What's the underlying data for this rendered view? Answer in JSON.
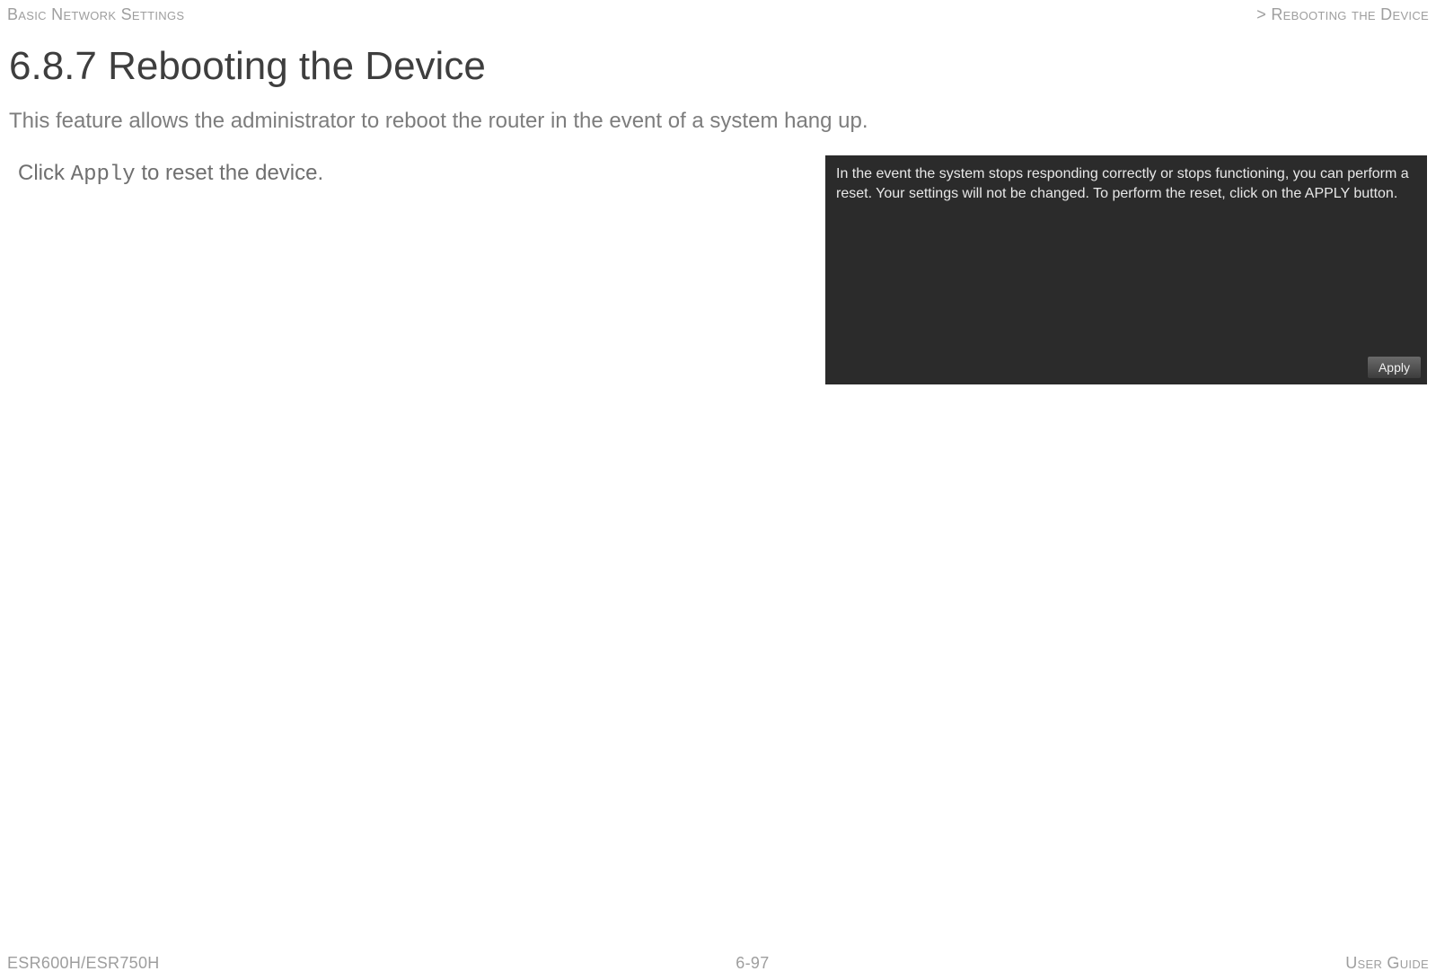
{
  "header": {
    "left": "Basic Network Settings",
    "right": "> Rebooting the Device"
  },
  "section": {
    "title": "6.8.7 Rebooting the Device",
    "intro": "This feature allows the administrator to reboot the router in the event of a system hang up."
  },
  "instruction": {
    "prefix": "Click ",
    "code": "Apply",
    "suffix": " to reset the device."
  },
  "panel": {
    "body": "In the event the system stops responding correctly or stops functioning, you can perform a reset. Your settings will not be changed. To perform the reset, click on the APPLY button.",
    "apply_label": "Apply"
  },
  "footer": {
    "left": "ESR600H/ESR750H",
    "center": "6-97",
    "right": "User Guide"
  }
}
